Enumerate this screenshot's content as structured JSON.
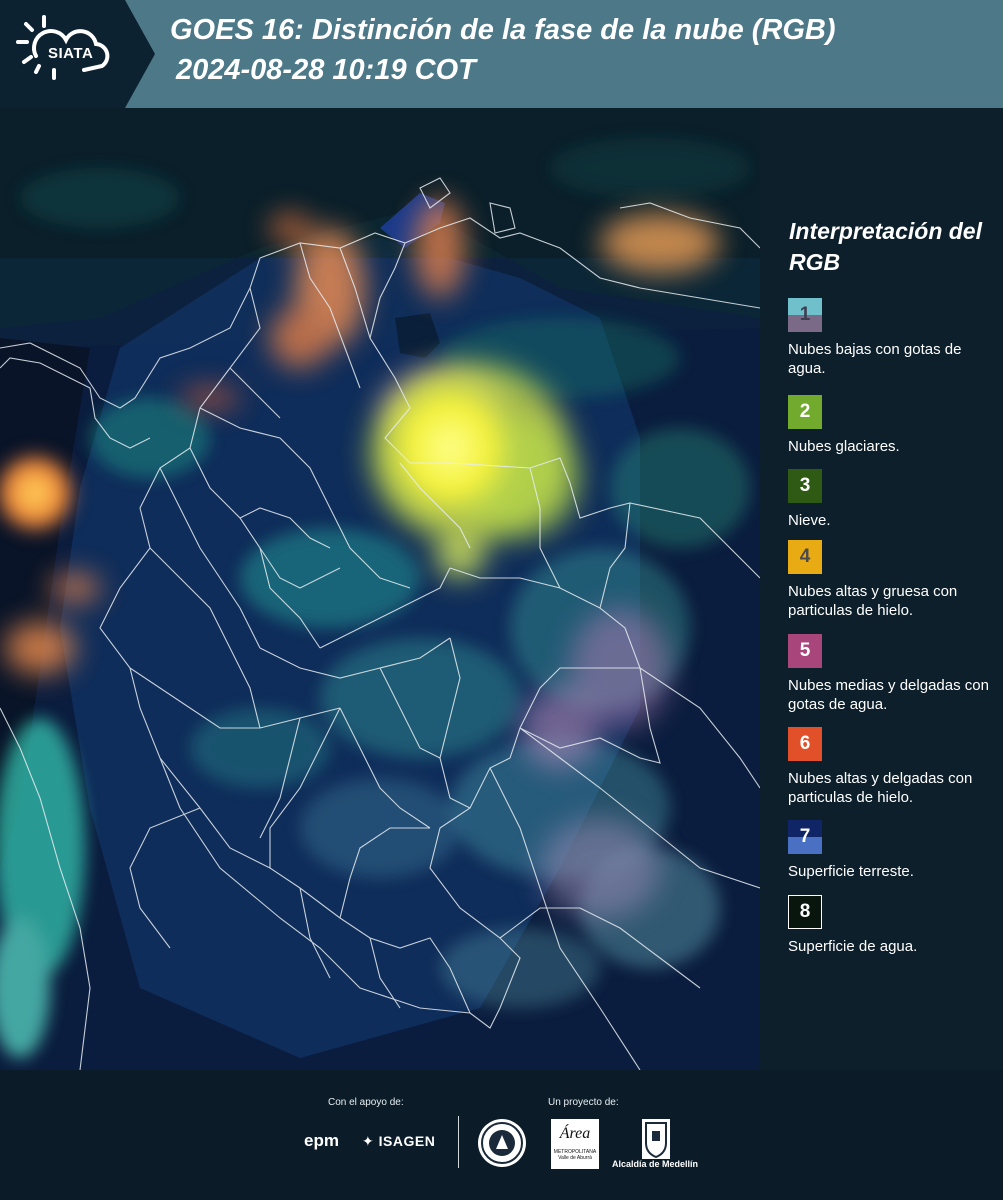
{
  "header": {
    "logo_text": "SIATA",
    "title_line1": "GOES 16: Distinción de la fase de la nube (RGB)",
    "title_line2": "2024-08-28 10:19 COT"
  },
  "legend": {
    "title": "Interpretación del RGB",
    "items": [
      {
        "number": "1",
        "label": "Nubes bajas con gotas de agua.",
        "color_top": "#6fc0cb",
        "color_bottom": "#7a6a88",
        "num_color": "#3d3d50",
        "border": ""
      },
      {
        "number": "2",
        "label": "Nubes glaciares.",
        "color_top": "#72aa2e",
        "color_bottom": "#72aa2e",
        "num_color": "#ffffff",
        "border": ""
      },
      {
        "number": "3",
        "label": "Nieve.",
        "color_top": "#2f5a14",
        "color_bottom": "#2f5a14",
        "num_color": "#ffffff",
        "border": ""
      },
      {
        "number": "4",
        "label": "Nubes altas y gruesa con particulas de hielo.",
        "color_top": "#e9ab14",
        "color_bottom": "#e9ab14",
        "num_color": "#4a4a4a",
        "border": ""
      },
      {
        "number": "5",
        "label": "Nubes medias y delgadas con gotas de agua.",
        "color_top": "#a8467c",
        "color_bottom": "#a8467c",
        "num_color": "#ffffff",
        "border": ""
      },
      {
        "number": "6",
        "label": "Nubes altas y delgadas con particulas de hielo.",
        "color_top": "#e2502a",
        "color_bottom": "#e2502a",
        "num_color": "#ffffff",
        "border": ""
      },
      {
        "number": "7",
        "label": "Superficie terreste.",
        "color_top": "#0f2566",
        "color_bottom": "#4a70c4",
        "num_color": "#ffffff",
        "border": ""
      },
      {
        "number": "8",
        "label": "Superficie de agua.",
        "color_top": "#08160d",
        "color_bottom": "#08160d",
        "num_color": "#ffffff",
        "border": "#ffffff"
      }
    ]
  },
  "footer": {
    "support_label": "Con el apoyo de:",
    "project_label": "Un proyecto de:",
    "epm": "epm",
    "isagen": "ISAGEN",
    "area_logo": "Área",
    "area_sub": "METROPOLITANA Valle de Aburrá",
    "alcaldia": "Alcaldía de Medellín"
  }
}
